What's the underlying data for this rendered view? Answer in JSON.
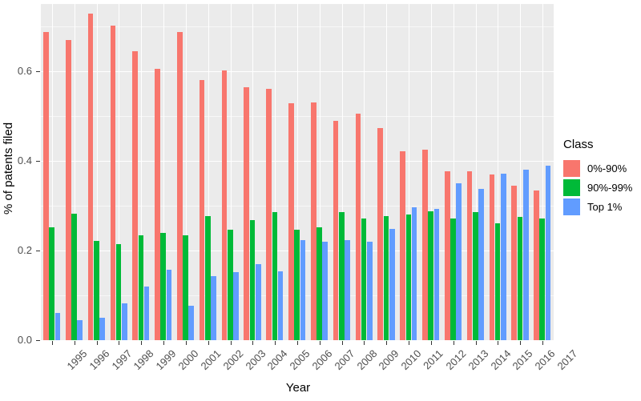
{
  "chart_data": {
    "type": "bar",
    "title": "",
    "xlabel": "Year",
    "ylabel": "% of patents filed",
    "grid": true,
    "legend_position": "right",
    "legend_title": "Class",
    "ylim": [
      0,
      0.75
    ],
    "y_ticks": [
      0.0,
      0.2,
      0.4,
      0.6
    ],
    "y_tick_labels": [
      "0.0",
      "0.2",
      "0.4",
      "0.6"
    ],
    "y_minor_ticks": [
      0.1,
      0.3,
      0.5,
      0.7
    ],
    "categories": [
      "1995",
      "1996",
      "1997",
      "1998",
      "1999",
      "2000",
      "2001",
      "2002",
      "2003",
      "2004",
      "2005",
      "2006",
      "2007",
      "2008",
      "2009",
      "2010",
      "2011",
      "2012",
      "2013",
      "2014",
      "2015",
      "2016",
      "2017"
    ],
    "series": [
      {
        "name": "0%-90%",
        "color": "#F8766D",
        "values": [
          0.687,
          0.67,
          0.728,
          0.701,
          0.645,
          0.605,
          0.687,
          0.581,
          0.601,
          0.565,
          0.561,
          0.528,
          0.53,
          0.49,
          0.506,
          0.473,
          0.422,
          0.425,
          0.377,
          0.377,
          0.369,
          0.345,
          0.334
        ]
      },
      {
        "name": "90%-99%",
        "color": "#00BA38",
        "values": [
          0.252,
          0.283,
          0.221,
          0.214,
          0.234,
          0.239,
          0.234,
          0.277,
          0.246,
          0.268,
          0.285,
          0.246,
          0.252,
          0.285,
          0.271,
          0.276,
          0.281,
          0.288,
          0.272,
          0.286,
          0.261,
          0.275,
          0.272
        ]
      },
      {
        "name": "Top 1%",
        "color": "#619CFF",
        "values": [
          0.061,
          0.045,
          0.05,
          0.083,
          0.12,
          0.158,
          0.077,
          0.142,
          0.152,
          0.17,
          0.153,
          0.224,
          0.22,
          0.223,
          0.22,
          0.249,
          0.297,
          0.293,
          0.35,
          0.337,
          0.372,
          0.38,
          0.39
        ]
      }
    ]
  },
  "axes": {
    "x_title": "Year",
    "y_title": "% of patents filed"
  },
  "legend": {
    "title": "Class",
    "items": [
      {
        "label": "0%-90%",
        "color": "#F8766D"
      },
      {
        "label": "90%-99%",
        "color": "#00BA38"
      },
      {
        "label": "Top 1%",
        "color": "#619CFF"
      }
    ]
  }
}
